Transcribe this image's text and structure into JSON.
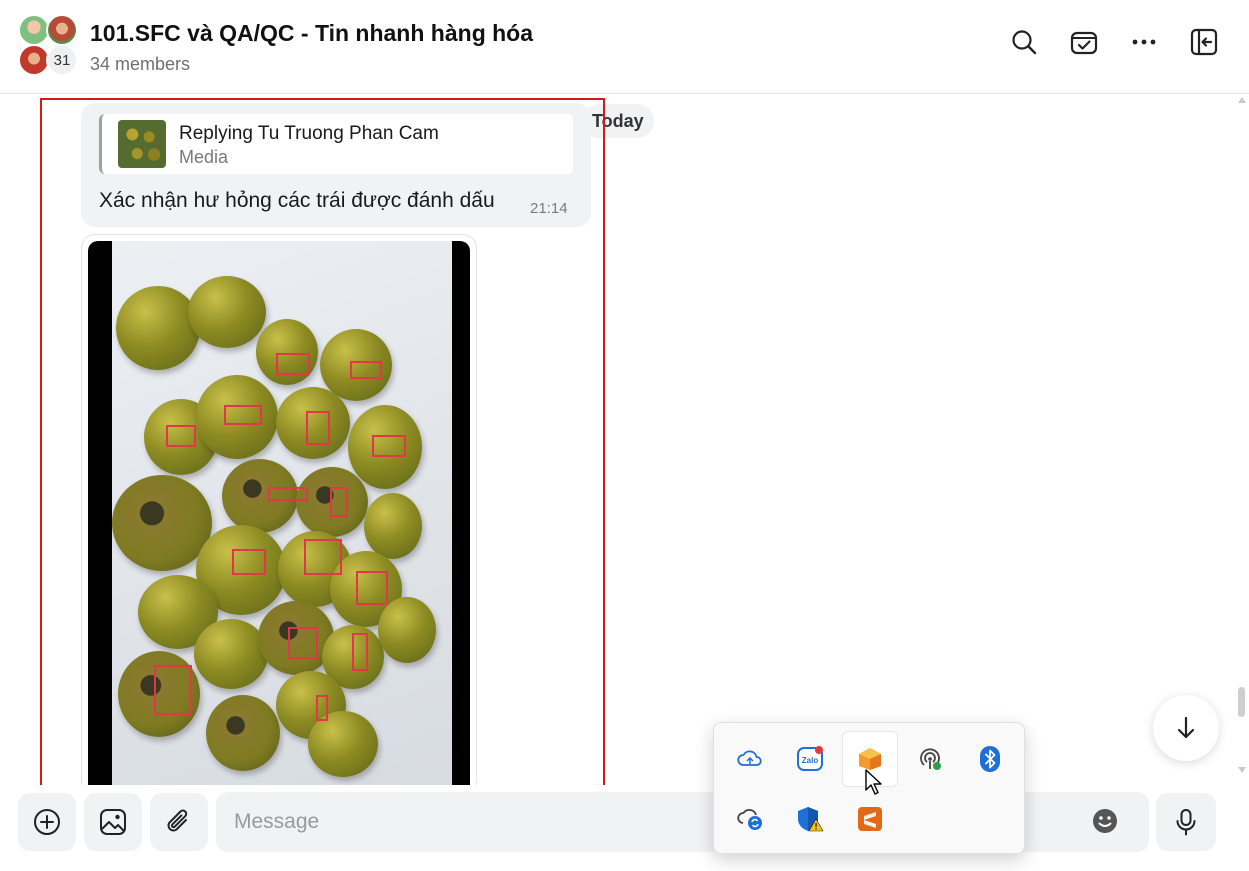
{
  "header": {
    "title": "101.SFC và QA/QC - Tin nhanh hàng hóa",
    "members": "34 members",
    "avatar_count": "31",
    "icons": [
      "search-icon",
      "calendar-check-icon",
      "more-icon",
      "collapse-panel-icon"
    ]
  },
  "chat": {
    "date_separator": "Today",
    "reply": {
      "quote_name": "Replying Tu Truong Phan Cam",
      "quote_type": "Media",
      "text": "Xác nhận hư hỏng các trái được đánh dấu",
      "time": "21:14"
    },
    "image_message": {
      "content": "photo of persimmons with red marked damage boxes"
    }
  },
  "composer": {
    "placeholder": "Message",
    "buttons": [
      "add-icon",
      "sticker-image-icon",
      "attach-icon",
      "emoji-icon",
      "mic-icon"
    ]
  },
  "tray": {
    "items": [
      "onedrive-cloud-icon",
      "zalo-icon",
      "app-orange-icon",
      "hotspot-icon",
      "bluetooth-icon",
      "sync-cloud-icon",
      "defender-shield-warning-icon",
      "sublime-text-icon"
    ]
  },
  "colors": {
    "highlight": "#d1191f",
    "bubble": "#f1f2f4",
    "mark": "#e0384a"
  }
}
